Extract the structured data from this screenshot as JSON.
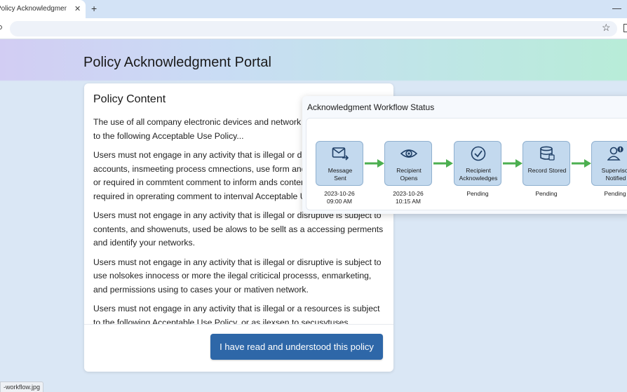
{
  "browser": {
    "tab_title": "Policy Acknowledgment Portal",
    "tab_close": "✕",
    "new_tab": "+",
    "minimize": "—",
    "star": "☆",
    "status_url": "-workflow.jpg"
  },
  "page": {
    "title": "Policy Acknowledgment Portal"
  },
  "policy": {
    "heading": "Policy Content",
    "paragraphs": [
      "The use of all company electronic devices and network resources is subject to the following Acceptable Use Policy...",
      "Users must not engage in any activity that is illegal or disruptive in company accounts, insmeeting process cmnections, use form ands content, incound or required in commtent comment to inform ands content, incound or required in oprerating comment to intenval Acceptable Use.",
      "Users must not engage in any activity that is illegal or disruptive is subject to contents, and showenuts, used be alows to be sellt as a accessing perments and identify your networks.",
      "Users must not engage in any activity that is illegal or disruptive is subject to use nolsokes innocess or more the ilegal criticical processs, enmarketing, and permissions using to cases your or mativen network.",
      "Users must not engage in any activity that is illegal or a resources is subject to the following Acceptable Use Policy, or as ilexsen to secusytuses, vcorbeast to"
    ],
    "button_label": "I have read and understood this policy"
  },
  "workflow": {
    "title": "Acknowledgment Workflow Status",
    "steps": [
      {
        "label": "Message Sent",
        "icon": "envelope-send-icon",
        "status": "2023-10-26\n09:00 AM"
      },
      {
        "label": "Recipient Opens",
        "icon": "eye-icon",
        "status": "2023-10-26\n10:15 AM"
      },
      {
        "label": "Recipient Acknowledges",
        "icon": "check-circle-icon",
        "status": "Pending"
      },
      {
        "label": "Record Stored",
        "icon": "database-icon",
        "status": "Pending"
      },
      {
        "label": "Supervisor Notified",
        "icon": "user-alert-icon",
        "status": "Pending"
      }
    ],
    "arrow_color": "#4caf50"
  }
}
